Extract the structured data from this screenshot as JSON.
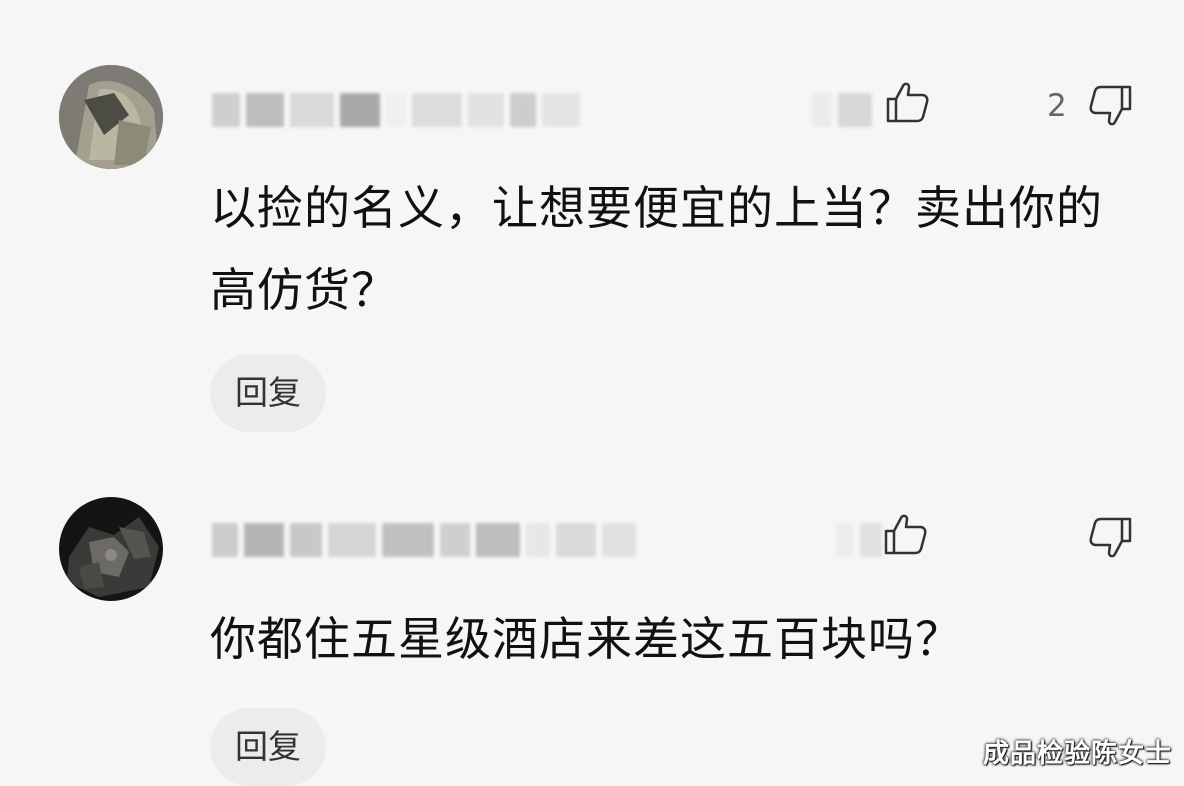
{
  "comments": [
    {
      "text": "以捡的名义，让想要便宜的上当？卖出你的高仿货？",
      "dislike_count": "2",
      "reply_label": "回复",
      "like_icon": "thumbs-up-icon",
      "dislike_icon": "thumbs-down-icon"
    },
    {
      "text": "你都住五星级酒店来差这五百块吗？",
      "dislike_count": "",
      "reply_label": "回复",
      "like_icon": "thumbs-up-icon",
      "dislike_icon": "thumbs-down-icon"
    }
  ],
  "watermark": "成品检验陈女士"
}
